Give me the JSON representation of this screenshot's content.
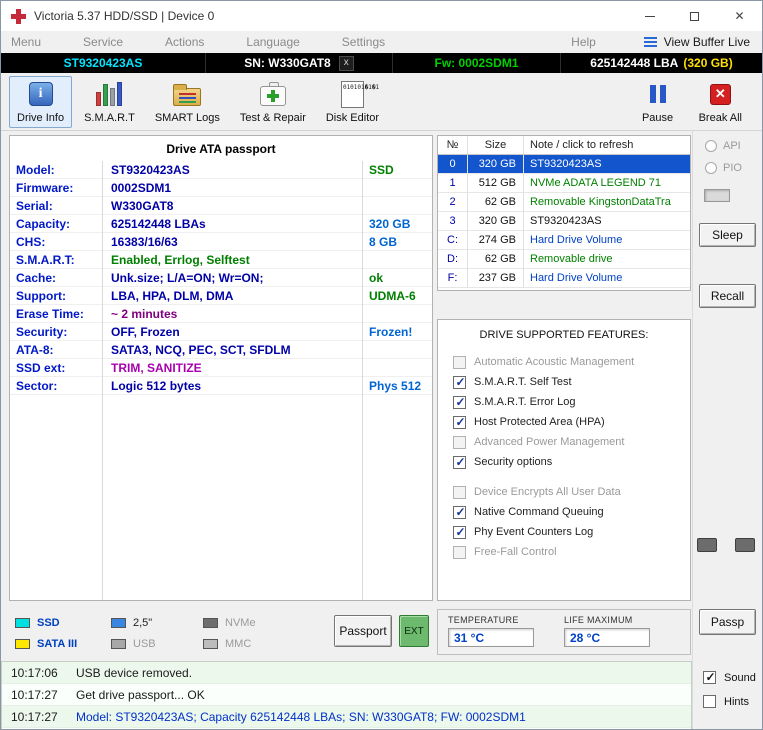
{
  "colors": {
    "label_blue": "#0018c8",
    "value_navy": "#0000a8",
    "value_green": "#008000",
    "value_purple": "#800080",
    "value_magenta": "#a800b0",
    "extra_blue": "#0064d2",
    "selected_row_bg": "#1255cc",
    "infobar_model_cyan": "#00e5ff",
    "infobar_fw_green": "#00d000",
    "infobar_capacity_yellow": "#ffe000",
    "ssd_swatch": "#00e0e0",
    "bay25_swatch": "#3a86e0",
    "sata_swatch": "#ffe800",
    "break_red": "#d42020",
    "pause_blue": "#2858c8"
  },
  "window": {
    "title": "Victoria 5.37 HDD/SSD | Device 0"
  },
  "menubar": {
    "items": [
      "Menu",
      "Service",
      "Actions",
      "Language",
      "Settings",
      "Help"
    ],
    "view_buffer": "View Buffer Live"
  },
  "infobar": {
    "model": "ST9320423AS",
    "serial": "SN: W330GAT8",
    "close_x": "x",
    "firmware": "Fw: 0002SDM1",
    "lba": "625142448 LBA",
    "capacity": "(320 GB)"
  },
  "toolbar": {
    "drive_info": "Drive Info",
    "smart": "S.M.A.R.T",
    "smart_logs": "SMART Logs",
    "test_repair": "Test & Repair",
    "disk_editor": "Disk Editor",
    "pause": "Pause",
    "break_all": "Break All"
  },
  "passport": {
    "title": "Drive ATA passport",
    "rows": [
      {
        "label": "Model:",
        "value": "ST9320423AS",
        "extra": "SSD"
      },
      {
        "label": "Firmware:",
        "value": "0002SDM1",
        "extra": ""
      },
      {
        "label": "Serial:",
        "value": "W330GAT8",
        "extra": ""
      },
      {
        "label": "Capacity:",
        "value": "625142448 LBAs",
        "extra": "320 GB"
      },
      {
        "label": "CHS:",
        "value": "16383/16/63",
        "extra": "8 GB"
      },
      {
        "label": "S.M.A.R.T:",
        "value": "Enabled, Errlog, Selftest",
        "extra": ""
      },
      {
        "label": "Cache:",
        "value": "Unk.size; L/A=ON; Wr=ON;",
        "extra": "ok"
      },
      {
        "label": "Support:",
        "value": "LBA, HPA, DLM, DMA",
        "extra": "UDMA-6"
      },
      {
        "label": "Erase Time:",
        "value": "~ 2 minutes",
        "extra": ""
      },
      {
        "label": "Security:",
        "value": "OFF, Frozen",
        "extra": "Frozen!"
      },
      {
        "label": "ATA-8:",
        "value": "SATA3, NCQ, PEC, SCT, SFDLM",
        "extra": ""
      },
      {
        "label": "SSD ext:",
        "value": "TRIM, SANITIZE",
        "extra": ""
      },
      {
        "label": "Sector:",
        "value": "Logic 512 bytes",
        "extra": "Phys 512"
      }
    ]
  },
  "devices": {
    "headers": {
      "num": "№",
      "size": "Size",
      "note": "Note / click to refresh"
    },
    "rows": [
      {
        "num": "0",
        "size": "320 GB",
        "note": "ST9320423AS",
        "selected": true
      },
      {
        "num": "1",
        "size": "512 GB",
        "note": "NVMe  ADATA LEGEND 71",
        "selected": false
      },
      {
        "num": "2",
        "size": "62 GB",
        "note": "Removable KingstonDataTra",
        "selected": false
      },
      {
        "num": "3",
        "size": "320 GB",
        "note": "ST9320423AS",
        "selected": false
      },
      {
        "num": "C:",
        "size": "274 GB",
        "note": "Hard Drive Volume",
        "selected": false
      },
      {
        "num": "D:",
        "size": "62 GB",
        "note": "Removable drive",
        "selected": false
      },
      {
        "num": "F:",
        "size": "237 GB",
        "note": "Hard Drive Volume",
        "selected": false
      }
    ]
  },
  "features": {
    "title": "DRIVE SUPPORTED FEATURES:",
    "items": [
      {
        "label": "Automatic Acoustic Management",
        "checked": false,
        "enabled": false
      },
      {
        "label": "S.M.A.R.T. Self Test",
        "checked": true,
        "enabled": true
      },
      {
        "label": "S.M.A.R.T. Error Log",
        "checked": true,
        "enabled": true
      },
      {
        "label": "Host Protected Area (HPA)",
        "checked": true,
        "enabled": true
      },
      {
        "label": "Advanced Power Management",
        "checked": false,
        "enabled": false
      },
      {
        "label": "Security options",
        "checked": true,
        "enabled": true
      },
      {
        "label": "Device Encrypts All User Data",
        "checked": false,
        "enabled": false
      },
      {
        "label": "Native Command Queuing",
        "checked": true,
        "enabled": true
      },
      {
        "label": "Phy Event Counters Log",
        "checked": true,
        "enabled": true
      },
      {
        "label": "Free-Fall Control",
        "checked": false,
        "enabled": false
      }
    ]
  },
  "legend": {
    "items": [
      {
        "label": "SSD",
        "color": "#00e0e0"
      },
      {
        "label": "2,5\"",
        "color": "#3a86e0"
      },
      {
        "label": "NVMe",
        "color": "#6e6e6e"
      },
      {
        "label": "SATA III",
        "color": "#ffe800"
      },
      {
        "label": "USB",
        "color": "#a8a8a8"
      },
      {
        "label": "MMC",
        "color": "#bcbcbc"
      }
    ]
  },
  "buttons": {
    "passport": "Passport",
    "ext": "EXT",
    "sleep": "Sleep",
    "recall": "Recall",
    "passp": "Passp"
  },
  "modes": {
    "api": "API",
    "pio": "PIO"
  },
  "temperature": {
    "temp_label": "TEMPERATURE",
    "temp_value": "31 °C",
    "life_label": "LIFE MAXIMUM",
    "life_value": "28 °C"
  },
  "log": {
    "entries": [
      {
        "time": "10:17:06",
        "text": "USB device removed.",
        "highlight": false
      },
      {
        "time": "10:17:27",
        "text": "Get drive passport... OK",
        "highlight": false
      },
      {
        "time": "10:17:27",
        "text": "Model: ST9320423AS; Capacity 625142448 LBAs; SN: W330GAT8; FW: 0002SDM1",
        "highlight": true
      }
    ]
  },
  "options": {
    "sound": "Sound",
    "hints": "Hints"
  }
}
